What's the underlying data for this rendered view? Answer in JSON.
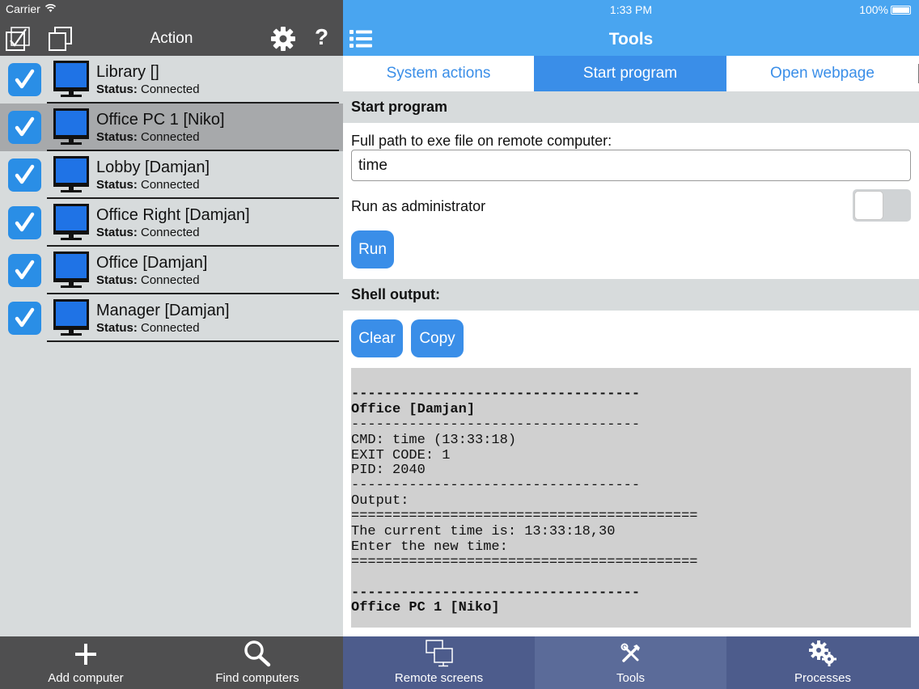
{
  "status_bar": {
    "carrier": "Carrier",
    "time": "1:33 PM",
    "battery": "100%"
  },
  "left_header": {
    "title": "Action"
  },
  "computers": [
    {
      "name": "Library []",
      "status_label": "Status:",
      "status_value": " Connected",
      "checked": true,
      "selected": false
    },
    {
      "name": "Office PC 1 [Niko]",
      "status_label": "Status:",
      "status_value": " Connected",
      "checked": true,
      "selected": true
    },
    {
      "name": "Lobby [Damjan]",
      "status_label": "Status:",
      "status_value": " Connected",
      "checked": true,
      "selected": false
    },
    {
      "name": "Office Right [Damjan]",
      "status_label": "Status:",
      "status_value": " Connected",
      "checked": true,
      "selected": false
    },
    {
      "name": "Office [Damjan]",
      "status_label": "Status:",
      "status_value": " Connected",
      "checked": true,
      "selected": false
    },
    {
      "name": "Manager [Damjan]",
      "status_label": "Status:",
      "status_value": " Connected",
      "checked": true,
      "selected": false
    }
  ],
  "left_bottom": {
    "add_label": "Add computer",
    "find_label": "Find computers"
  },
  "right_header": {
    "title": "Tools"
  },
  "tabs": [
    {
      "label": "System actions",
      "active": false
    },
    {
      "label": "Start program",
      "active": true
    },
    {
      "label": "Open webpage",
      "active": false
    }
  ],
  "start_program": {
    "section_title": "Start program",
    "path_label": "Full path to exe file on remote computer:",
    "path_value": "time",
    "admin_label": "Run as administrator",
    "admin_enabled": false,
    "run_label": "Run"
  },
  "shell_output": {
    "section_title": "Shell output:",
    "clear_label": "Clear",
    "copy_label": "Copy",
    "lines": [
      {
        "text": "-----------------------------------",
        "bold": true
      },
      {
        "text": "Office [Damjan]",
        "bold": true
      },
      {
        "text": "-----------------------------------",
        "bold": false
      },
      {
        "text": "CMD: time (13:33:18)",
        "bold": false
      },
      {
        "text": "EXIT CODE: 1",
        "bold": false
      },
      {
        "text": "PID: 2040",
        "bold": false
      },
      {
        "text": "-----------------------------------",
        "bold": false
      },
      {
        "text": "Output:",
        "bold": false
      },
      {
        "text": "==========================================",
        "bold": false
      },
      {
        "text": "The current time is: 13:33:18,30",
        "bold": false
      },
      {
        "text": "Enter the new time:",
        "bold": false
      },
      {
        "text": "==========================================",
        "bold": false
      },
      {
        "text": "",
        "bold": false
      },
      {
        "text": "-----------------------------------",
        "bold": true
      },
      {
        "text": "Office PC 1 [Niko]",
        "bold": true
      }
    ]
  },
  "bottom_tabs": [
    {
      "label": "Remote screens",
      "icon": "remote-screens-icon",
      "active": false
    },
    {
      "label": "Tools",
      "icon": "tools-icon",
      "active": true
    },
    {
      "label": "Processes",
      "icon": "processes-icon",
      "active": false
    }
  ],
  "colors": {
    "accent_blue": "#3a8ee8",
    "header_blue": "#49a5f0",
    "left_dark": "#4f4f50",
    "bottom_nav": "#4d5c8c",
    "console_bg": "#d0d0d0"
  }
}
